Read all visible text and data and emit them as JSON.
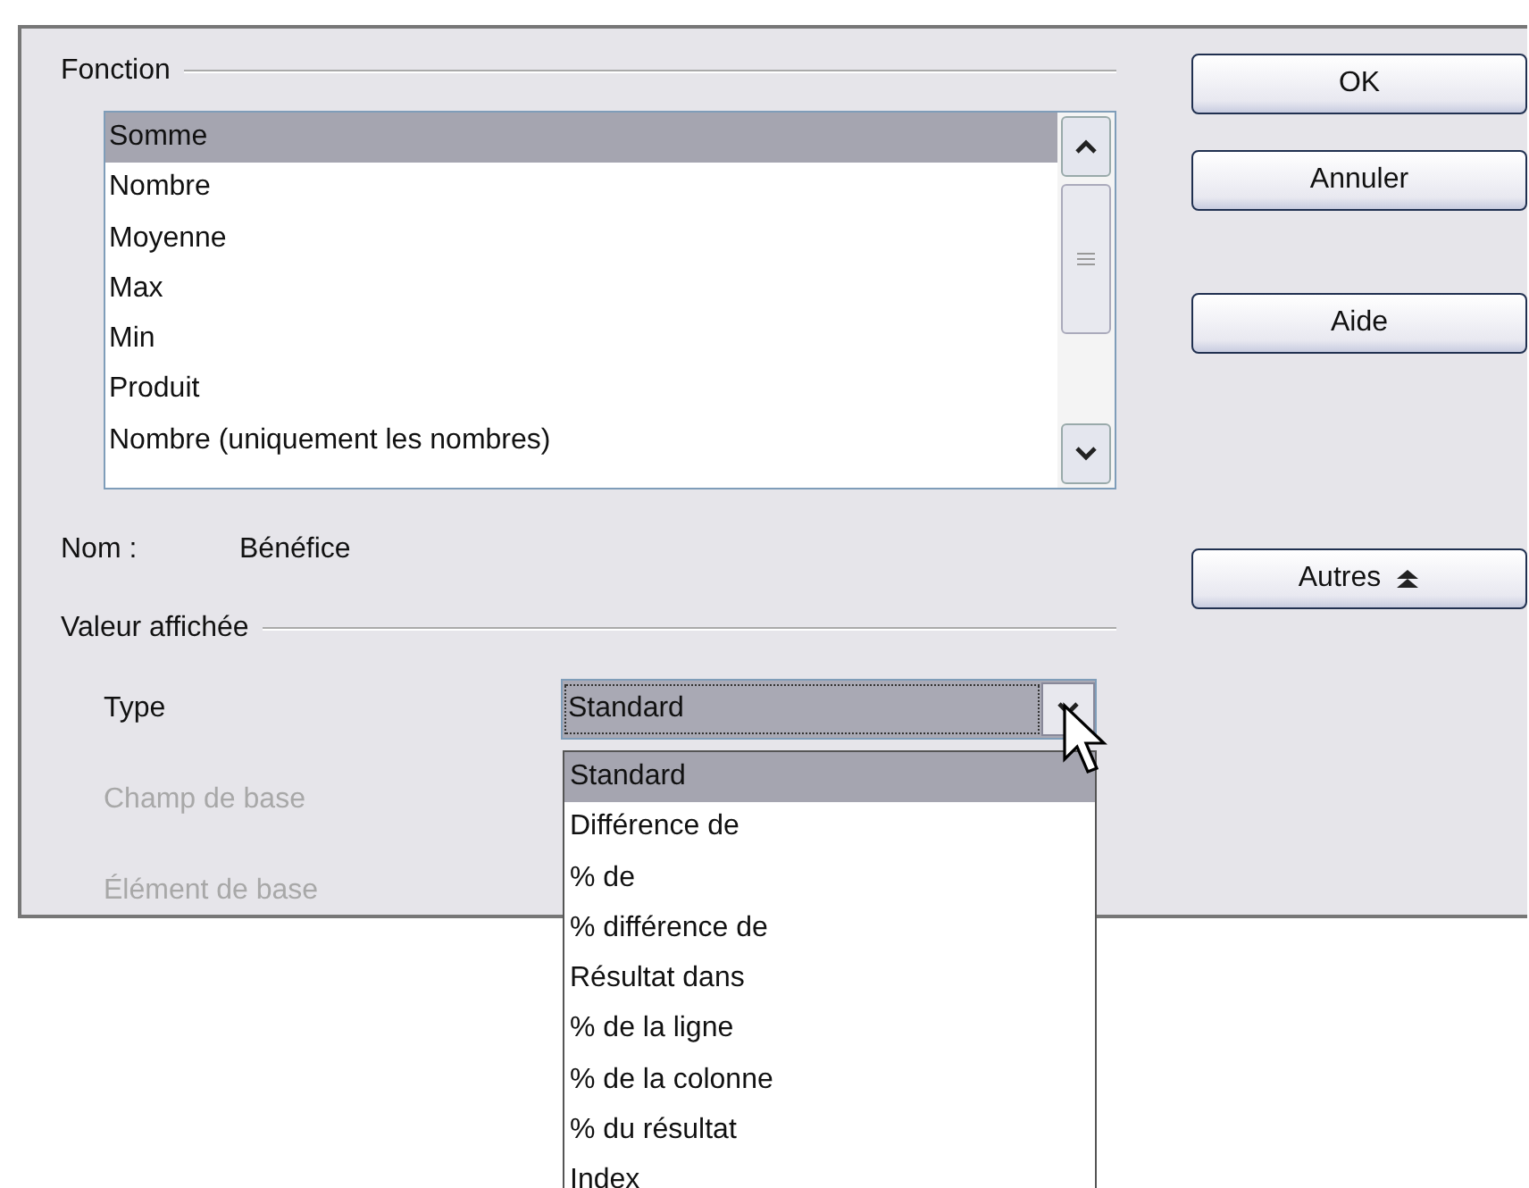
{
  "fonction": {
    "label": "Fonction",
    "items": [
      {
        "label": "Somme",
        "selected": true
      },
      {
        "label": "Nombre",
        "selected": false
      },
      {
        "label": "Moyenne",
        "selected": false
      },
      {
        "label": "Max",
        "selected": false
      },
      {
        "label": "Min",
        "selected": false
      },
      {
        "label": "Produit",
        "selected": false
      },
      {
        "label": "Nombre (uniquement les nombres)",
        "selected": false
      }
    ]
  },
  "nom": {
    "label": "Nom :",
    "value": "Bénéfice"
  },
  "valeur_affichee": {
    "label": "Valeur affichée",
    "type": {
      "label": "Type",
      "value": "Standard",
      "expanded": true,
      "options": [
        {
          "label": "Standard",
          "selected": true
        },
        {
          "label": "Différence de",
          "selected": false
        },
        {
          "label": "% de",
          "selected": false
        },
        {
          "label": "% différence de",
          "selected": false
        },
        {
          "label": "Résultat dans",
          "selected": false
        },
        {
          "label": "% de la ligne",
          "selected": false
        },
        {
          "label": "% de la colonne",
          "selected": false
        },
        {
          "label": "% du résultat",
          "selected": false
        },
        {
          "label": "Index",
          "selected": false
        }
      ]
    },
    "fields": [
      {
        "label": "Champ de base",
        "disabled": true
      },
      {
        "label": "Élément de base",
        "disabled": true
      }
    ]
  },
  "buttons": [
    {
      "label": "OK",
      "kind": "push"
    },
    {
      "label": "Annuler",
      "kind": "push"
    },
    {
      "label": "Aide",
      "kind": "push"
    },
    {
      "label": "Autres",
      "kind": "expander"
    }
  ]
}
